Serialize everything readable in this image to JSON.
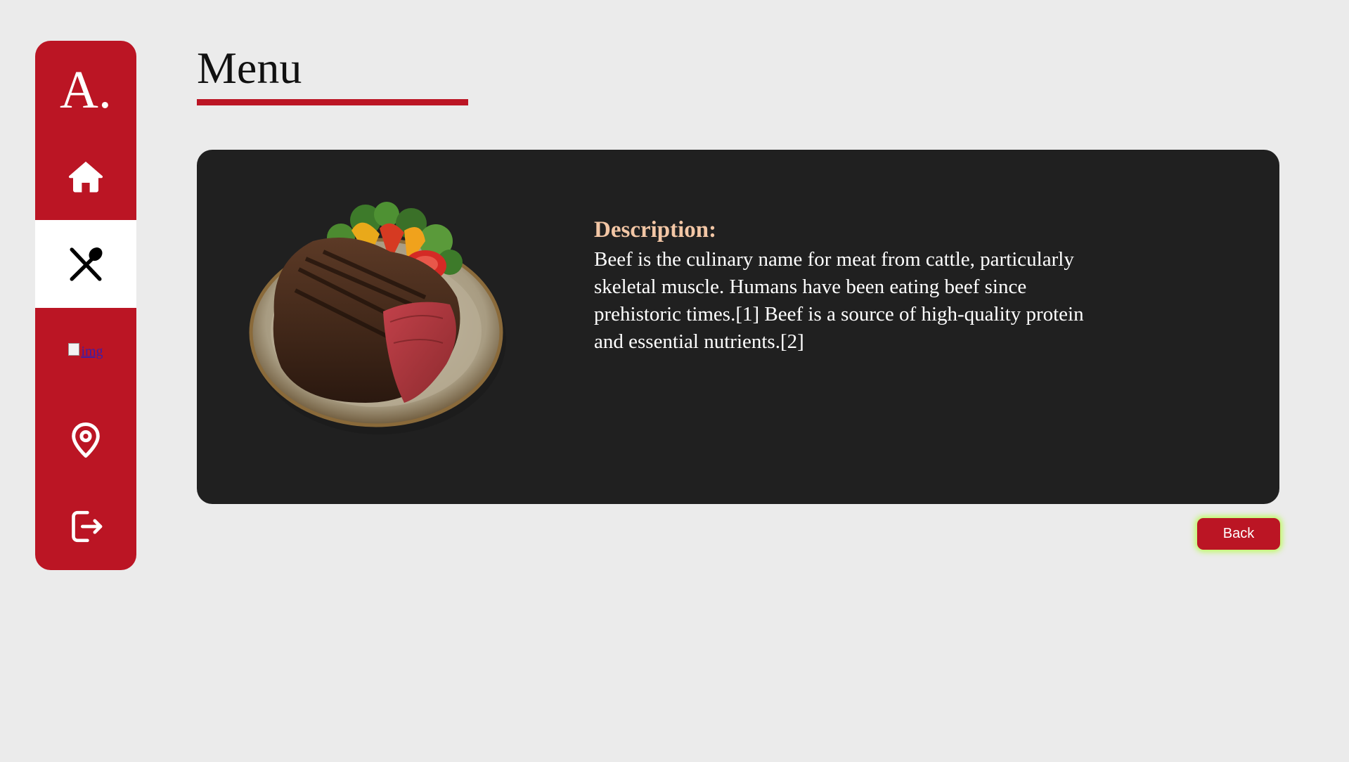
{
  "sidebar": {
    "brand": "A.",
    "items": [
      {
        "icon": "home-icon",
        "active": false
      },
      {
        "icon": "utensils-icon",
        "active": true
      },
      {
        "icon": "broken-image-icon",
        "alt_text": "img",
        "active": false
      },
      {
        "icon": "location-pin-icon",
        "active": false
      },
      {
        "icon": "logout-icon",
        "active": false
      }
    ]
  },
  "page": {
    "title": "Menu"
  },
  "card": {
    "image_icon": "steak-plate-image",
    "description_heading": "Description:",
    "description_text": "Beef is the culinary name for meat from cattle, particularly skeletal muscle. Humans have been eating beef since prehistoric times.[1] Beef is a source of high-quality protein and essential nutrients.[2]"
  },
  "actions": {
    "back_label": "Back"
  },
  "colors": {
    "accent": "#bb1524",
    "background": "#ebebeb",
    "card": "#202020",
    "heading": "#f2c6a5"
  }
}
